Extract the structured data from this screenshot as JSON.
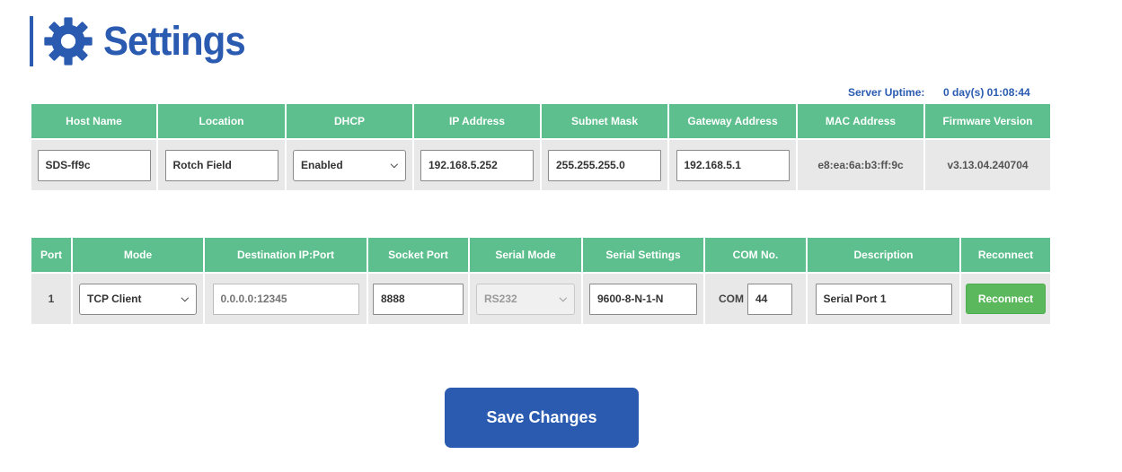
{
  "page": {
    "title": "Settings"
  },
  "uptime": {
    "label": "Server Uptime:",
    "value": "0 day(s) 01:08:44"
  },
  "network": {
    "headers": [
      "Host Name",
      "Location",
      "DHCP",
      "IP Address",
      "Subnet Mask",
      "Gateway Address",
      "MAC Address",
      "Firmware Version"
    ],
    "host_name": "SDS-ff9c",
    "location": "Rotch Field",
    "dhcp": "Enabled",
    "ip_address": "192.168.5.252",
    "subnet_mask": "255.255.255.0",
    "gateway": "192.168.5.1",
    "mac_address": "e8:ea:6a:b3:ff:9c",
    "firmware": "v3.13.04.240704"
  },
  "serial": {
    "headers": [
      "Port",
      "Mode",
      "Destination IP:Port",
      "Socket Port",
      "Serial Mode",
      "Serial Settings",
      "COM No.",
      "Description",
      "Reconnect"
    ],
    "port": "1",
    "mode": "TCP Client",
    "destination": "0.0.0.0:12345",
    "socket_port": "8888",
    "serial_mode": "RS232",
    "serial_settings": "9600-8-N-1-N",
    "com_prefix": "COM",
    "com_no": "44",
    "description": "Serial Port 1",
    "reconnect_label": "Reconnect"
  },
  "save_label": "Save Changes",
  "colors": {
    "accent": "#2a5bb0",
    "header_green": "#5cbf8d",
    "button_green": "#5cb85c"
  },
  "icons": {
    "title": "gear-icon",
    "dropdown": "chevron-down-icon"
  }
}
